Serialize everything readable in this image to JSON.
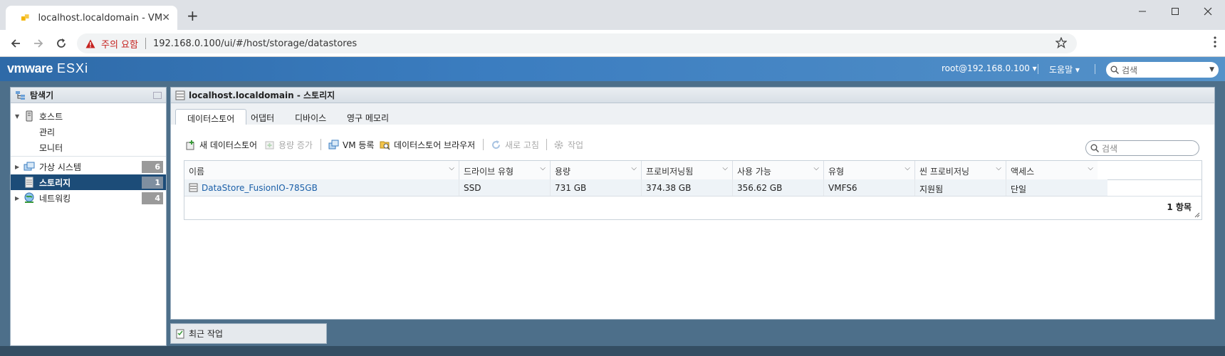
{
  "browser": {
    "tab_title": "localhost.localdomain - VMware",
    "url": "192.168.0.100/ui/#/host/storage/datastores",
    "warning": "주의 요함"
  },
  "header": {
    "brand_vm": "vmware",
    "brand_esxi": "ESXi",
    "user": "root@192.168.0.100 ▾",
    "help": "도움말 ▾",
    "search_placeholder": "검색"
  },
  "navigator": {
    "title": "탐색기",
    "host": "호스트",
    "host_children": [
      "관리",
      "모니터"
    ],
    "items": [
      {
        "label": "가상 시스템",
        "count": "6"
      },
      {
        "label": "스토리지",
        "count": "1"
      },
      {
        "label": "네트워킹",
        "count": "4"
      }
    ]
  },
  "main": {
    "title": "localhost.localdomain - 스토리지",
    "tabs": [
      "데이터스토어",
      "어댑터",
      "디바이스",
      "영구 메모리"
    ],
    "toolbar": {
      "new_datastore": "새 데이터스토어",
      "increase_capacity": "용량 증가",
      "register_vm": "VM 등록",
      "browser": "데이터스토어 브라우저",
      "refresh": "새로 고침",
      "actions": "작업"
    },
    "search_placeholder": "검색",
    "columns": [
      "이름",
      "드라이브 유형",
      "용량",
      "프로비저닝됨",
      "사용 가능",
      "유형",
      "씬 프로비저닝",
      "액세스"
    ],
    "rows": [
      [
        "DataStore_FusionIO-785GB",
        "SSD",
        "731 GB",
        "374.38 GB",
        "356.62 GB",
        "VMFS6",
        "지원됨",
        "단일"
      ]
    ],
    "item_count": "1 항목"
  },
  "recent_tasks": "최근 작업",
  "colors": {
    "header_blue": "#3b7dc0",
    "selected_nav": "#1c4c78",
    "link": "#1a5fa8"
  }
}
